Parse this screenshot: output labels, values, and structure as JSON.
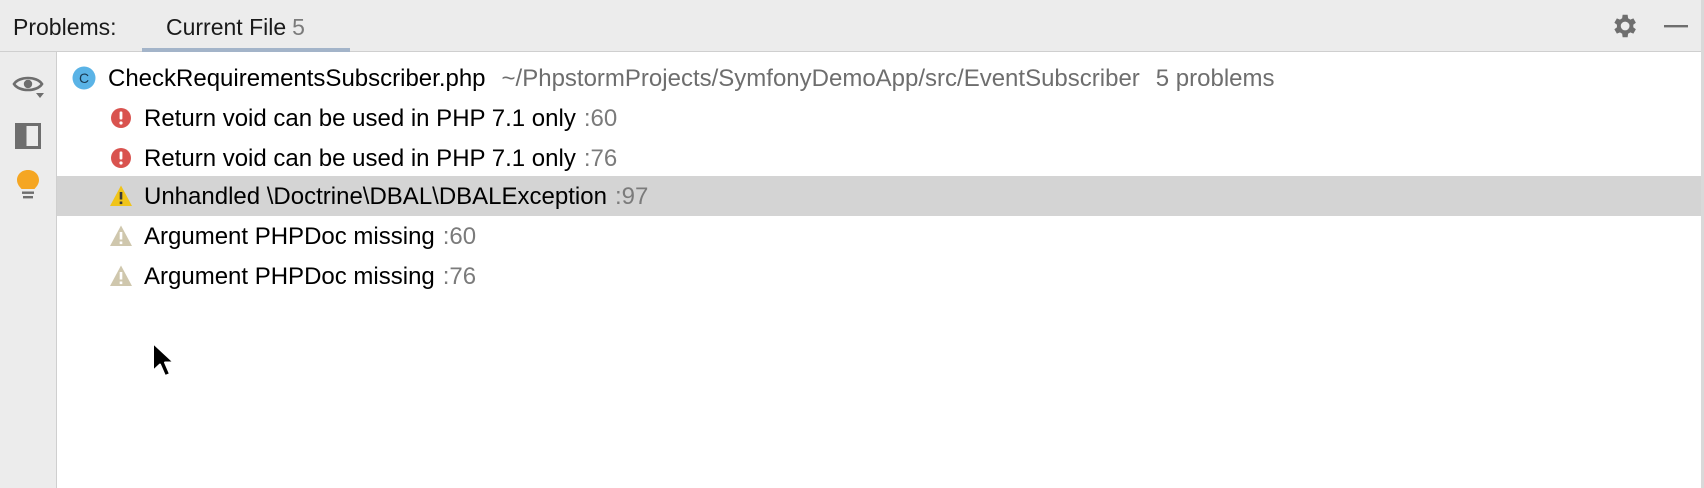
{
  "header": {
    "title": "Problems:",
    "tab": {
      "label": "Current File",
      "count": "5"
    },
    "icons": [
      "gear-icon",
      "minimize-icon"
    ]
  },
  "sidebar": {
    "buttons": [
      "eye-icon",
      "preview-icon",
      "lightbulb-icon"
    ]
  },
  "tree": {
    "file": {
      "icon": "class-c-icon",
      "name": "CheckRequirementsSubscriber.php",
      "path": "~/PhpstormProjects/SymfonyDemoApp/src/EventSubscriber",
      "count": "5 problems"
    },
    "problems": [
      {
        "severity": "error",
        "icon": "error-icon",
        "message": "Return void can be used in PHP 7.1 only",
        "line": ":60"
      },
      {
        "severity": "error",
        "icon": "error-icon",
        "message": "Return void can be used in PHP 7.1 only",
        "line": ":76"
      },
      {
        "severity": "warning",
        "icon": "warning-icon",
        "message": "Unhandled \\Doctrine\\DBAL\\DBALException",
        "line": ":97"
      },
      {
        "severity": "weak-warning",
        "icon": "weak-warning-icon",
        "message": "Argument PHPDoc missing",
        "line": ":60"
      },
      {
        "severity": "weak-warning",
        "icon": "weak-warning-icon",
        "message": "Argument PHPDoc missing",
        "line": ":76"
      }
    ],
    "selected_index": 2
  },
  "colors": {
    "error": "#d9534f",
    "warning": "#f0c419",
    "weak_warning": "#cfc7ad",
    "selection": "#d4d4d4",
    "tab_underline": "#a3b4c9",
    "file_icon": "#5ab3e6",
    "lightbulb": "#f5a623"
  }
}
